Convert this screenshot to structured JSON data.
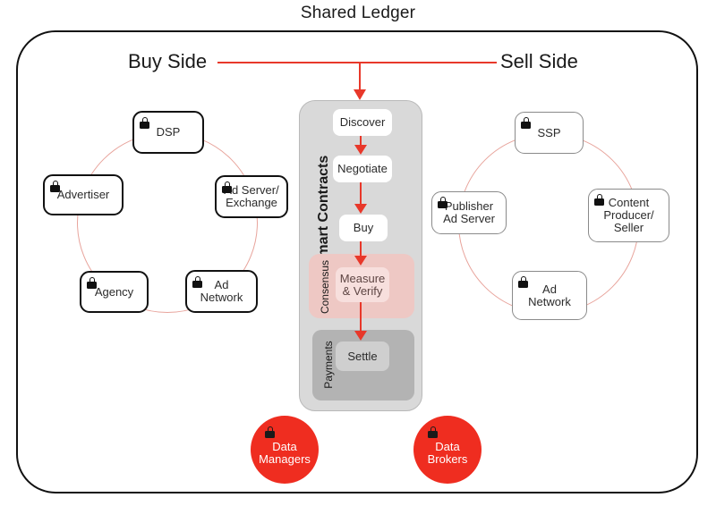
{
  "title": "Shared Ledger",
  "sides": {
    "buy_label": "Buy Side",
    "sell_label": "Sell Side"
  },
  "buy_side_nodes": [
    {
      "id": "dsp",
      "label": "DSP",
      "locked": true
    },
    {
      "id": "advertiser",
      "label": "Advertiser",
      "locked": true
    },
    {
      "id": "ad-server-exchange",
      "label": "Ad Server/\nExchange",
      "locked": true
    },
    {
      "id": "agency",
      "label": "Agency",
      "locked": true
    },
    {
      "id": "ad-network",
      "label": "Ad\nNetwork",
      "locked": true
    }
  ],
  "sell_side_nodes": [
    {
      "id": "ssp",
      "label": "SSP",
      "locked": true
    },
    {
      "id": "publisher-ad-server",
      "label": "Publisher\nAd Server",
      "locked": true
    },
    {
      "id": "content-producer-seller",
      "label": "Content\nProducer/\nSeller",
      "locked": true
    },
    {
      "id": "ad-network",
      "label": "Ad\nNetwork",
      "locked": true
    }
  ],
  "smart_contracts": {
    "title": "Smart Contracts",
    "steps": [
      {
        "id": "discover",
        "label": "Discover"
      },
      {
        "id": "negotiate",
        "label": "Negotiate"
      },
      {
        "id": "buy",
        "label": "Buy"
      },
      {
        "id": "measure-verify",
        "label": "Measure\n& Verify"
      },
      {
        "id": "settle",
        "label": "Settle"
      }
    ],
    "bands": [
      {
        "id": "consensus",
        "label": "Consensus"
      },
      {
        "id": "payments",
        "label": "Payments"
      }
    ]
  },
  "data_entities": [
    {
      "id": "data-managers",
      "label": "Data\nManagers",
      "locked": true
    },
    {
      "id": "data-brokers",
      "label": "Data\nBrokers",
      "locked": true
    }
  ],
  "colors": {
    "accent_red": "#e8382a",
    "circle_red": "#ef2d20",
    "ring_stroke": "#e8a49c",
    "panel_gray": "#d9d9d9",
    "consensus_pink": "#eec8c4",
    "payments_gray": "#b3b3b3",
    "boundary_black": "#111111"
  }
}
